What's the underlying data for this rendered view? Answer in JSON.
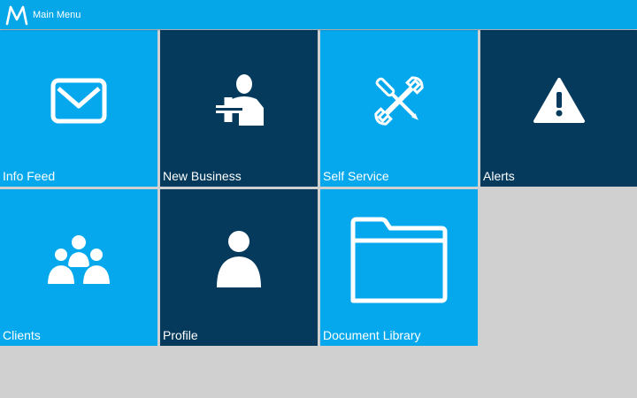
{
  "header": {
    "title": "Main Menu",
    "logo_icon": "brand-m-logo",
    "color": "#06a7e8"
  },
  "colors": {
    "tile_light": "#05a8ec",
    "tile_dark": "#053a5c",
    "background": "#d0d0d0"
  },
  "tiles": [
    {
      "label": "Info Feed",
      "icon": "envelope-icon",
      "style": "light"
    },
    {
      "label": "New Business",
      "icon": "add-person-icon",
      "style": "dark"
    },
    {
      "label": "Self Service",
      "icon": "tools-icon",
      "style": "light"
    },
    {
      "label": "Alerts",
      "icon": "warning-icon",
      "style": "dark"
    },
    {
      "label": "Clients",
      "icon": "group-icon",
      "style": "light"
    },
    {
      "label": "Profile",
      "icon": "person-icon",
      "style": "dark"
    },
    {
      "label": "Document Library",
      "icon": "folder-icon",
      "style": "light"
    }
  ]
}
